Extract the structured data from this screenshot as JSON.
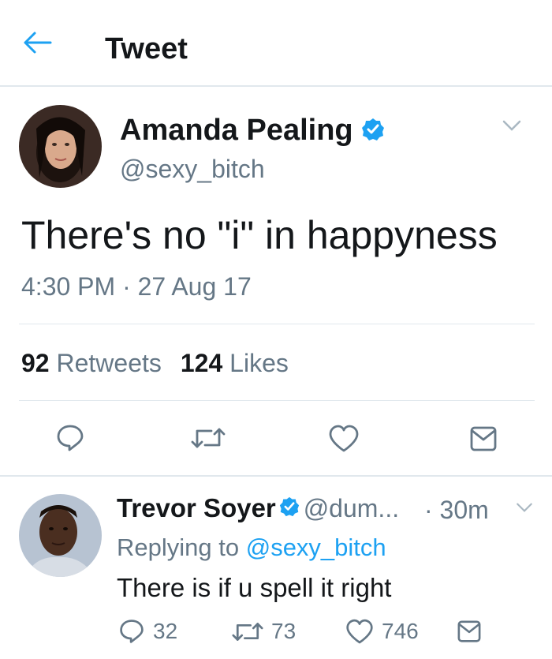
{
  "header": {
    "title": "Tweet"
  },
  "tweet": {
    "author_name": "Amanda Pealing",
    "author_handle": "@sexy_bitch",
    "text": "There's no \"i\" in happyness",
    "time": "4:30 PM · 27 Aug 17",
    "retweets_count": "92",
    "retweets_label": "Retweets",
    "likes_count": "124",
    "likes_label": "Likes"
  },
  "reply": {
    "author_name": "Trevor Soyer",
    "author_handle": "@dum...",
    "age": "· 30m",
    "replying_prefix": "Replying to",
    "replying_to": "@sexy_bitch",
    "text": "There is if u spell it right",
    "reply_count": "32",
    "retweet_count": "73",
    "like_count": "746"
  },
  "colors": {
    "accent": "#1da1f2",
    "text": "#14171a",
    "muted": "#657786",
    "divider": "#e1e8ed"
  },
  "icons": [
    "back-arrow-icon",
    "verified-badge-icon",
    "chevron-down-icon",
    "reply-icon",
    "retweet-icon",
    "like-icon",
    "share-icon"
  ]
}
